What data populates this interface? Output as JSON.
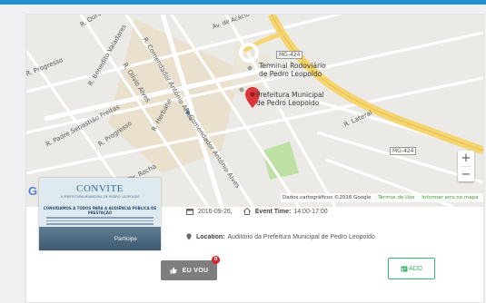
{
  "map": {
    "streets": [
      "R. Ouro",
      "R. Benedito Valadares",
      "R. Olívio Alves",
      "R. Comendador Antônio Alves",
      "R. Comendador Antônio Alves",
      "R. Progresso",
      "R. Padre Sebastião Freitas",
      "R. Progresso",
      "R. Herbane",
      "R. Dr. Rocha",
      "R. Lateral",
      "Av. de Acácio"
    ],
    "places": {
      "terminal_line1": "Terminal Rodoviário",
      "terminal_line2": "de Pedro Leopoldo",
      "prefeitura_line1": "Prefeitura Municipal",
      "prefeitura_line2": "de Pedro Leopoldo"
    },
    "highway_badges": [
      "MG-424",
      "MG-424"
    ],
    "zoom_in": "+",
    "zoom_out": "−",
    "google_logo": "G",
    "attribution": {
      "map_data": "Dados cartográficos ©2016 Google",
      "terms": "Termos de Uso",
      "report": "Informar erro no mapa"
    }
  },
  "flyer": {
    "title": "CONVITE",
    "subtitle": "A PREFEITURA MUNICIPAL DE PEDRO LEOPOLDO",
    "headline": "CONVIDAMOS A TODOS PARA A AUDIÊNCIA PÚBLICA DE PRESTAÇÃO",
    "word": "Participe"
  },
  "event": {
    "date": "2016-09-26,",
    "time_label": "Event Time:",
    "time_value": "14:00-17:00",
    "location_label": "Location:",
    "location_value": "Auditório da Prefeitura Municipal de Pedro Leopoldo"
  },
  "actions": {
    "attend_label": "EU VOU",
    "attend_count": "0",
    "add_label": "ADD"
  },
  "colors": {
    "accent": "#3bb56a",
    "badge": "#d9232d",
    "marker": "#d9373a",
    "topbar": "#1f8fd1"
  }
}
